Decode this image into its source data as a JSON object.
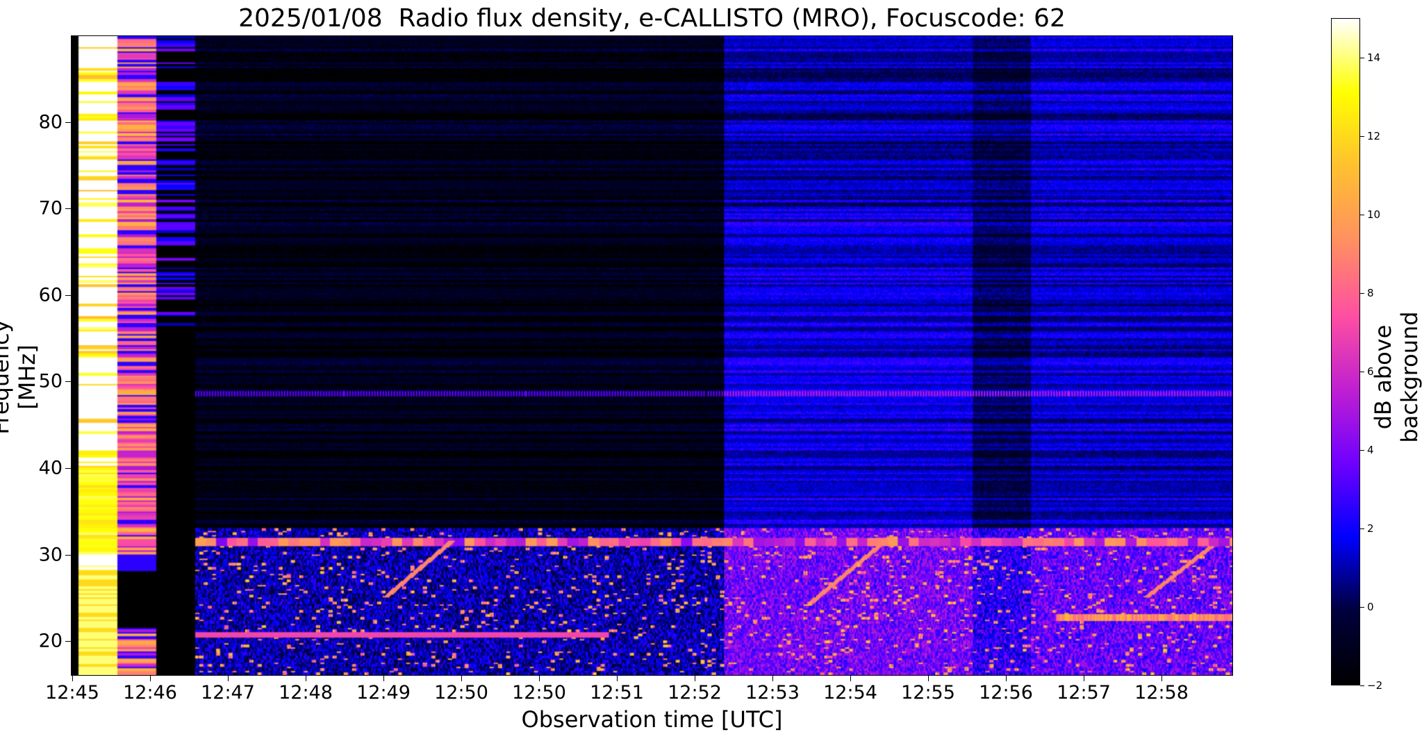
{
  "chart_data": {
    "type": "heatmap",
    "title": "2025/01/08  Radio flux density, e-CALLISTO (MRO), Focuscode: 62",
    "xlabel": "Observation time [UTC]",
    "ylabel": "Frequency [MHz]",
    "x_tick_labels": [
      "12:45",
      "12:46",
      "12:47",
      "12:48",
      "12:49",
      "12:50",
      "12:50",
      "12:51",
      "12:52",
      "12:53",
      "12:54",
      "12:55",
      "12:56",
      "12:57",
      "12:58"
    ],
    "y_ticks": [
      20,
      30,
      40,
      50,
      60,
      70,
      80
    ],
    "ylim": [
      16,
      90
    ],
    "colorbar": {
      "label": "dB above background",
      "range": [
        -2,
        15
      ],
      "ticks": [
        -2,
        0,
        2,
        4,
        6,
        8,
        10,
        12,
        14
      ],
      "colormap": [
        "#000000",
        "#00003c",
        "#0000ff",
        "#7000ff",
        "#c020d0",
        "#ff50a0",
        "#ff9060",
        "#ffc030",
        "#ffff00",
        "#ffffff"
      ]
    },
    "grid": false
  }
}
